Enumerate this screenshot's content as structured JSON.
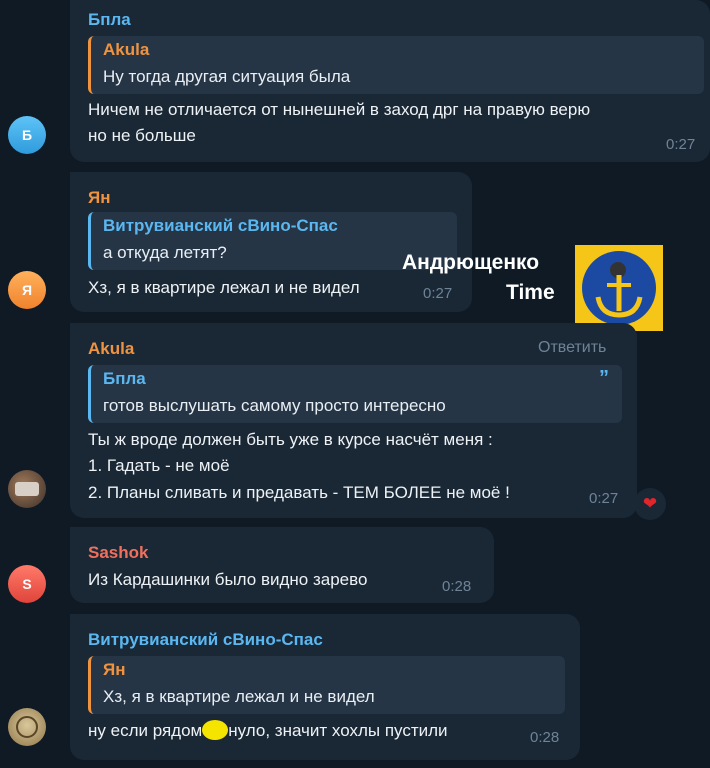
{
  "messages": [
    {
      "avatar_letter": "Б",
      "sender": "Бпла",
      "reply_author": "Akula",
      "reply_text": "Ну тогда другая ситуация была",
      "text_line1": "Ничем не отличается от нынешней в заход дрг на правую верю",
      "text_line2": "но не больше",
      "time": "0:27"
    },
    {
      "avatar_letter": "Я",
      "sender": "Ян",
      "reply_author": "Витрувианский сВино-Спас",
      "reply_text": "а откуда летят?",
      "text": "Хз, я в квартире лежал и не видел",
      "time": "0:27"
    },
    {
      "sender": "Akula",
      "reply_action": "Ответить",
      "reply_author": "Бпла",
      "reply_text": "готов выслушать самому просто интересно",
      "text_line1": "Ты ж вроде должен быть уже в курсе насчёт меня :",
      "text_line2": "1. Гадать - не моё",
      "text_line3": "2. Планы сливать и предавать - ТЕМ БОЛЕЕ не моё !",
      "time": "0:27",
      "reaction": "❤"
    },
    {
      "avatar_letter": "S",
      "sender": "Sashok",
      "text": "Из Кардашинки было видно зарево",
      "time": "0:28"
    },
    {
      "sender": "Витрувианский сВино-Спас",
      "reply_author": "Ян",
      "reply_text": "Хз, я в квартире лежал и не видел",
      "text_before": "ну если рядом",
      "text_after": "нуло, значит хохлы пустили",
      "time": "0:28"
    }
  ],
  "watermark": {
    "line1": "Андрющенко",
    "line2": "Time"
  },
  "colors": {
    "background": "#0f1a25",
    "bubble": "#1a2836",
    "orange_name": "#f0933f",
    "blue_name": "#5bb7f0",
    "red_name": "#f0705e"
  }
}
